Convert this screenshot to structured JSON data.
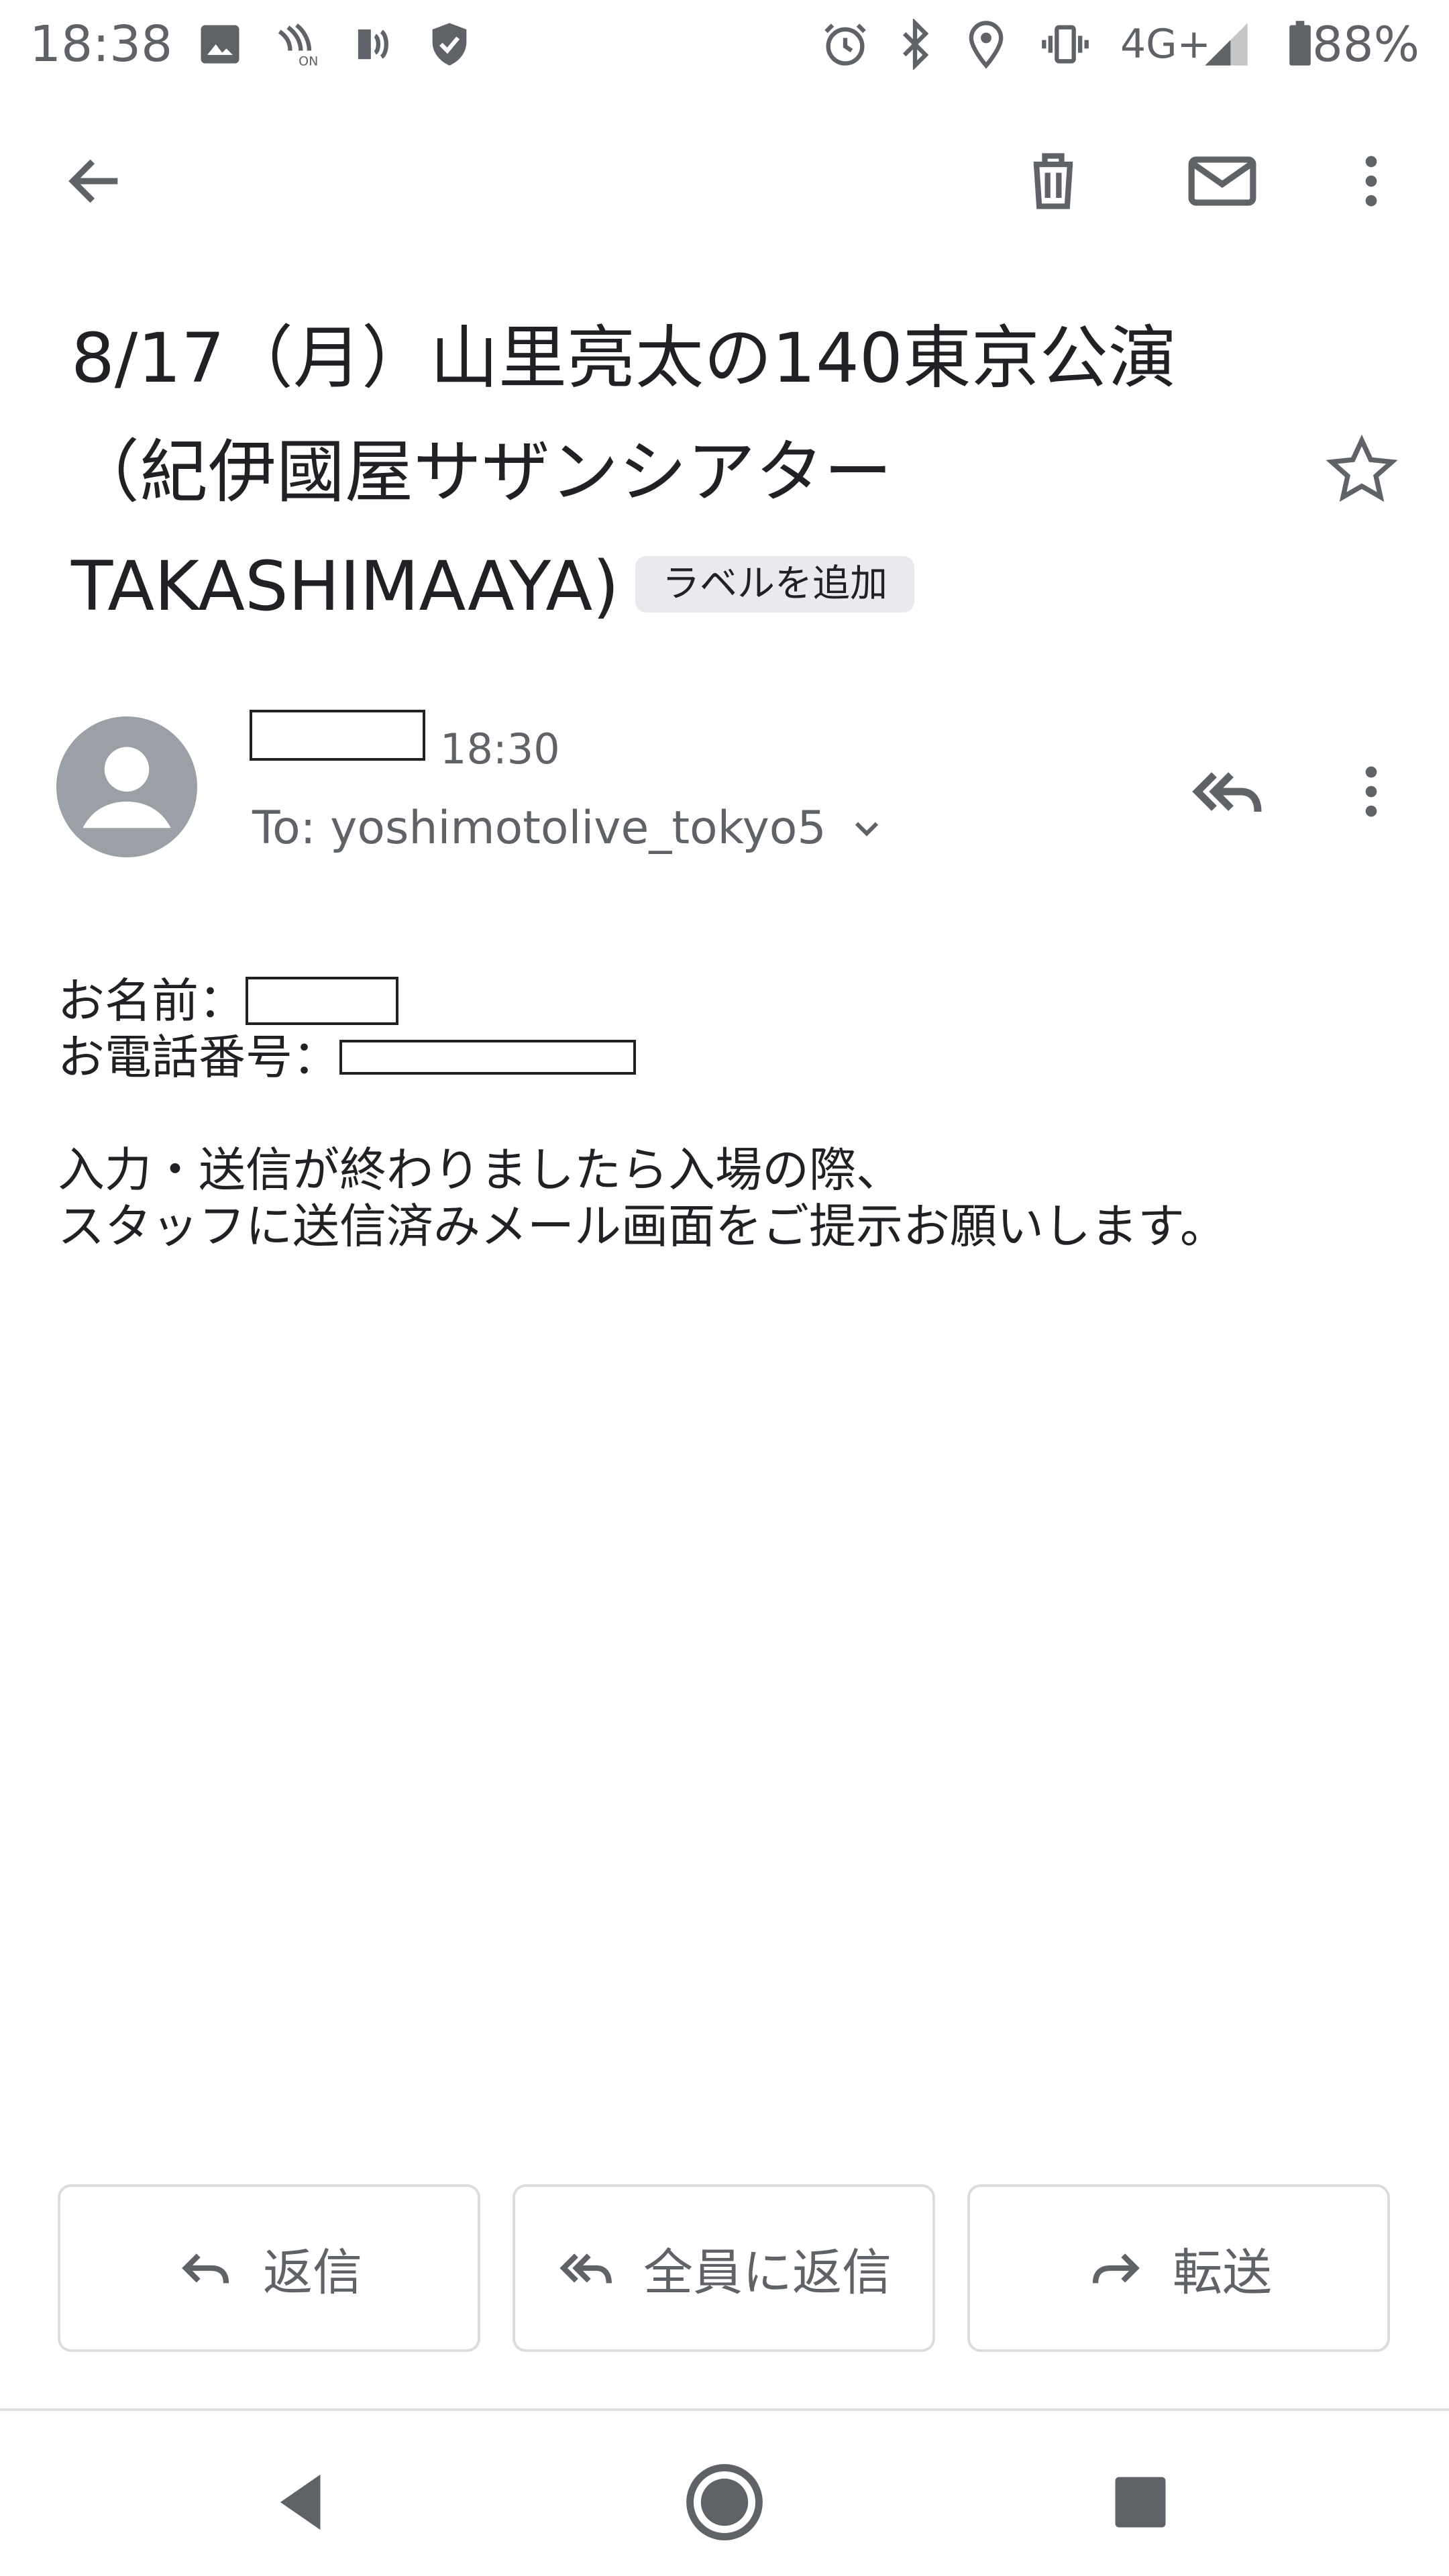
{
  "status_bar": {
    "time": "18:38",
    "network": "4G+",
    "battery": "88%"
  },
  "email": {
    "subject": "8/17（月）山里亮太の140東京公演（紀伊國屋サザンシアターTAKASHIMAAYA)",
    "label_chip": "ラベルを追加",
    "sent_time": "18:30",
    "recipient": "To: yoshimotolive_tokyo5",
    "body": {
      "name_label": "お名前：",
      "phone_label": "お電話番号：",
      "line1": "入力・送信が終わりましたら入場の際、",
      "line2": "スタッフに送信済みメール画面をご提示お願いします。"
    }
  },
  "actions": {
    "reply": "返信",
    "reply_all": "全員に返信",
    "forward": "転送"
  },
  "icons": {
    "back": "arrow-left-icon",
    "delete": "trash-icon",
    "mark_unread": "mail-icon",
    "more": "more-vert-icon",
    "star": "star-outline-icon",
    "reply_all": "reply-all-icon"
  },
  "colors": {
    "text_primary": "#202124",
    "text_secondary": "#5f6368",
    "avatar_bg": "#9aa0a6",
    "chip_bg": "#e8eaed",
    "button_border": "#dadce0"
  }
}
